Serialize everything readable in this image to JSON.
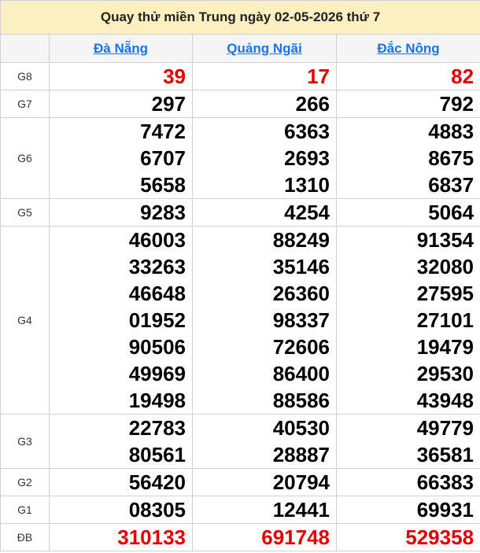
{
  "title": "Quay thử miền Trung ngày 02-05-2026 thứ 7",
  "provinces": [
    "Đà Nẵng",
    "Quảng Ngãi",
    "Đắc Nông"
  ],
  "prizes": [
    {
      "label": "G8",
      "values": [
        [
          "39"
        ],
        [
          "17"
        ],
        [
          "82"
        ]
      ],
      "red": true
    },
    {
      "label": "G7",
      "values": [
        [
          "297"
        ],
        [
          "266"
        ],
        [
          "792"
        ]
      ]
    },
    {
      "label": "G6",
      "values": [
        [
          "7472",
          "6707",
          "5658"
        ],
        [
          "6363",
          "2693",
          "1310"
        ],
        [
          "4883",
          "8675",
          "6837"
        ]
      ]
    },
    {
      "label": "G5",
      "values": [
        [
          "9283"
        ],
        [
          "4254"
        ],
        [
          "5064"
        ]
      ]
    },
    {
      "label": "G4",
      "values": [
        [
          "46003",
          "33263",
          "46648",
          "01952",
          "90506",
          "49969",
          "19498"
        ],
        [
          "88249",
          "35146",
          "26360",
          "98337",
          "72606",
          "86400",
          "88586"
        ],
        [
          "91354",
          "32080",
          "27595",
          "27101",
          "19479",
          "29530",
          "43948"
        ]
      ]
    },
    {
      "label": "G3",
      "values": [
        [
          "22783",
          "80561"
        ],
        [
          "40530",
          "28887"
        ],
        [
          "49779",
          "36581"
        ]
      ]
    },
    {
      "label": "G2",
      "values": [
        [
          "56420"
        ],
        [
          "20794"
        ],
        [
          "66383"
        ]
      ]
    },
    {
      "label": "G1",
      "values": [
        [
          "08305"
        ],
        [
          "12441"
        ],
        [
          "69931"
        ]
      ]
    },
    {
      "label": "ĐB",
      "values": [
        [
          "310133"
        ],
        [
          "691748"
        ],
        [
          "529358"
        ]
      ],
      "red": true
    }
  ]
}
